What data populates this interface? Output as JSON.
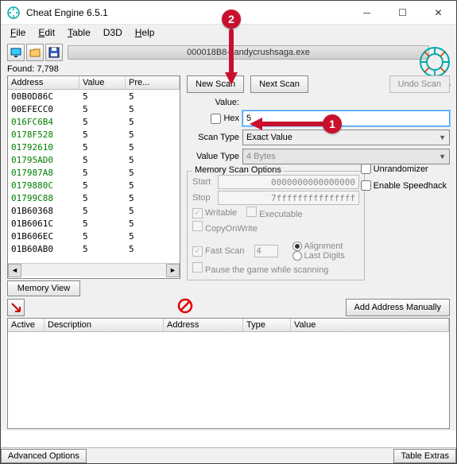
{
  "window": {
    "title": "Cheat Engine 6.5.1"
  },
  "menubar": [
    "File",
    "Edit",
    "Table",
    "D3D",
    "Help"
  ],
  "process": {
    "name": "000018B8-candycrushsaga.exe"
  },
  "found": {
    "label": "Found:",
    "count": "7,798"
  },
  "results": {
    "columns": {
      "address": "Address",
      "value": "Value",
      "prev": "Pre..."
    },
    "rows": [
      {
        "addr": "00B0D86C",
        "val": "5",
        "prev": "5",
        "green": false
      },
      {
        "addr": "00EFECC0",
        "val": "5",
        "prev": "5",
        "green": false
      },
      {
        "addr": "016FC6B4",
        "val": "5",
        "prev": "5",
        "green": true
      },
      {
        "addr": "0178F528",
        "val": "5",
        "prev": "5",
        "green": true
      },
      {
        "addr": "01792610",
        "val": "5",
        "prev": "5",
        "green": true
      },
      {
        "addr": "01795AD0",
        "val": "5",
        "prev": "5",
        "green": true
      },
      {
        "addr": "017987A8",
        "val": "5",
        "prev": "5",
        "green": true
      },
      {
        "addr": "0179880C",
        "val": "5",
        "prev": "5",
        "green": true
      },
      {
        "addr": "01799C88",
        "val": "5",
        "prev": "5",
        "green": true
      },
      {
        "addr": "01B60368",
        "val": "5",
        "prev": "5",
        "green": false
      },
      {
        "addr": "01B6061C",
        "val": "5",
        "prev": "5",
        "green": false
      },
      {
        "addr": "01B606EC",
        "val": "5",
        "prev": "5",
        "green": false
      },
      {
        "addr": "01B60AB0",
        "val": "5",
        "prev": "5",
        "green": false
      }
    ]
  },
  "buttons": {
    "memoryView": "Memory View",
    "newScan": "New Scan",
    "nextScan": "Next Scan",
    "undoScan": "Undo Scan",
    "addAddress": "Add Address Manually",
    "advancedOptions": "Advanced Options",
    "tableExtras": "Table Extras"
  },
  "labels": {
    "value": "Value:",
    "hex": "Hex",
    "scanType": "Scan Type",
    "valueType": "Value Type",
    "memScanOpts": "Memory Scan Options",
    "start": "Start",
    "stop": "Stop",
    "writable": "Writable",
    "executable": "Executable",
    "copyOnWrite": "CopyOnWrite",
    "fastScan": "Fast Scan",
    "alignment": "Alignment",
    "lastDigits": "Last Digits",
    "pauseGame": "Pause the game while scanning",
    "unrandomizer": "Unrandomizer",
    "speedhack": "Enable Speedhack",
    "settings": "Settings"
  },
  "fields": {
    "value": "5",
    "scanType": "Exact Value",
    "valueType": "4 Bytes",
    "start": "0000000000000000",
    "stop": "7fffffffffffffff",
    "fastScan": "4"
  },
  "cheatTable": {
    "columns": {
      "active": "Active",
      "desc": "Description",
      "addr": "Address",
      "type": "Type",
      "val": "Value"
    }
  },
  "annotations": {
    "one": "1",
    "two": "2"
  }
}
